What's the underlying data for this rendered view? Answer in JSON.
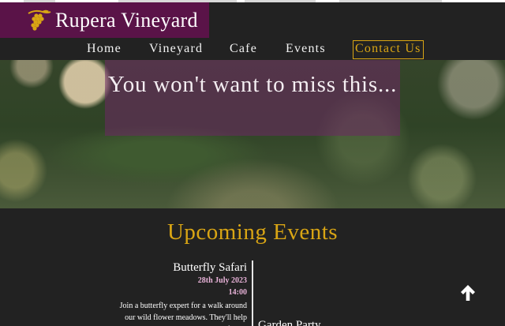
{
  "brand": {
    "name": "Rupera Vineyard",
    "logo_icon": "grape-vine-icon",
    "logo_color": "#5a1348"
  },
  "nav": {
    "items": [
      {
        "label": "Home"
      },
      {
        "label": "Vineyard"
      },
      {
        "label": "Cafe"
      },
      {
        "label": "Events"
      },
      {
        "label": "Contact Us",
        "highlight": true
      }
    ],
    "accent_color": "#d9a514"
  },
  "hero": {
    "title": "You won't want to miss this..."
  },
  "events": {
    "heading": "Upcoming Events",
    "items": [
      {
        "title": "Butterfly Safari",
        "date": "28th July 2023",
        "time": "14:00",
        "description": "Join a butterfly expert for a walk around our wild flower meadows. They'll help you to identify and"
      },
      {
        "title": "Garden Party"
      }
    ]
  },
  "scroll_up": {
    "icon": "arrow-up-icon"
  }
}
